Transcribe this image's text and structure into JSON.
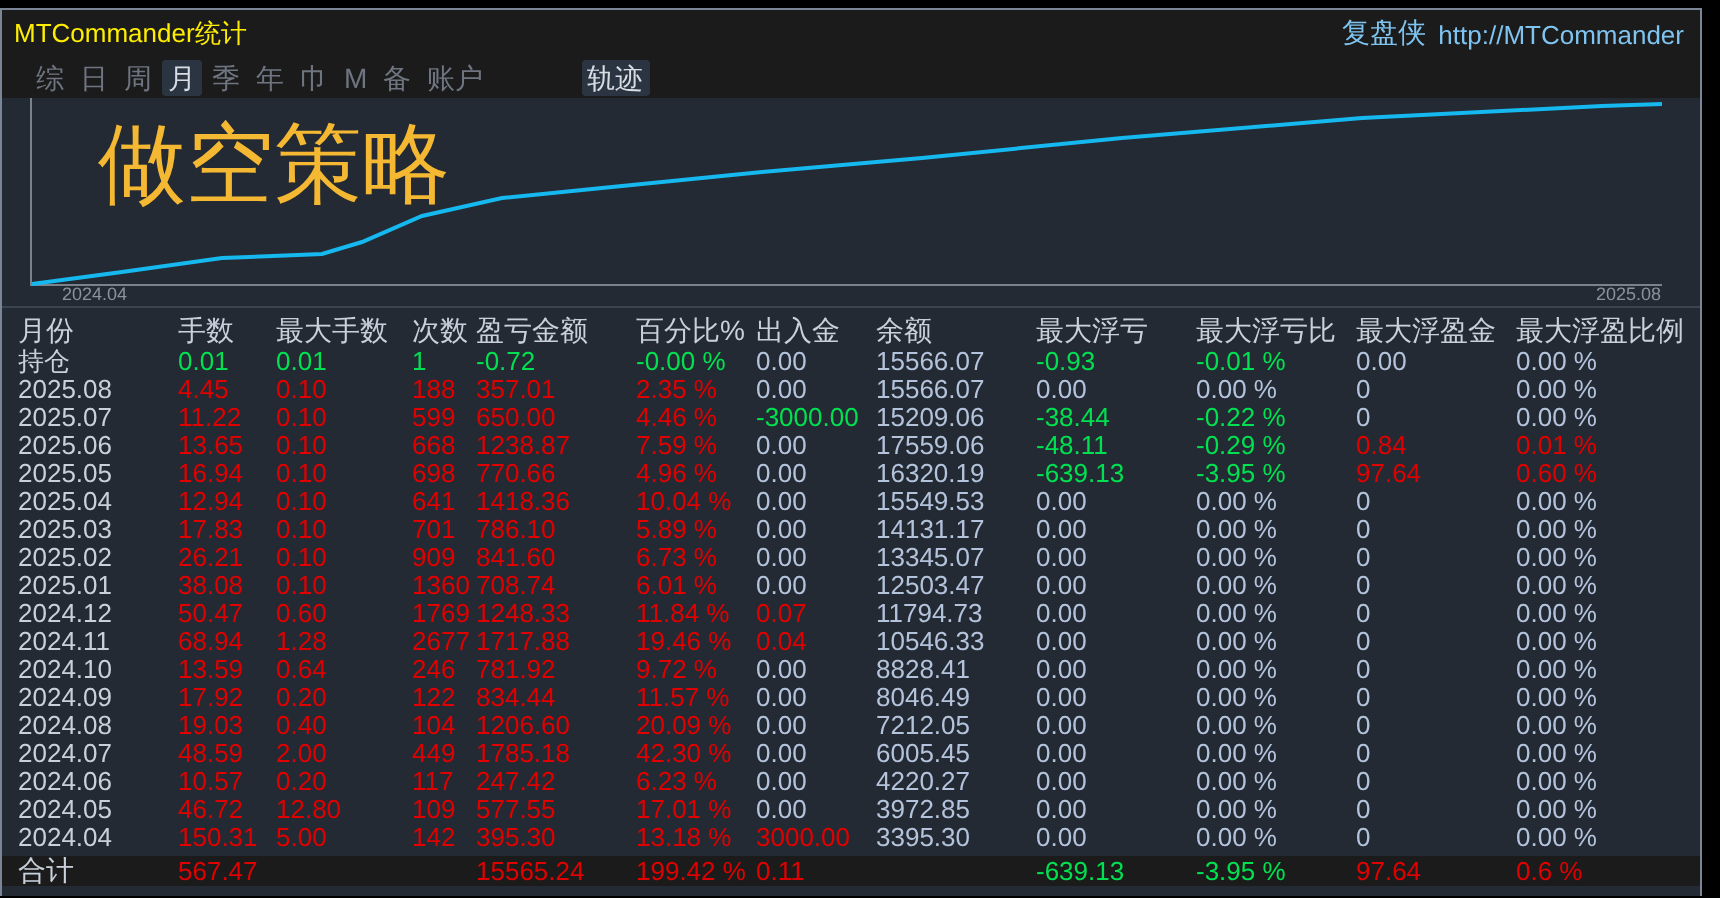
{
  "window": {
    "title": "MTCommander统计",
    "brand": "复盘侠",
    "url": "http://MTCommander"
  },
  "period_tabs": [
    {
      "label": "综",
      "selected": false
    },
    {
      "label": "日",
      "selected": false
    },
    {
      "label": "周",
      "selected": false
    },
    {
      "label": "月",
      "selected": true
    },
    {
      "label": "季",
      "selected": false
    },
    {
      "label": "年",
      "selected": false
    },
    {
      "label": "巾",
      "selected": false
    },
    {
      "label": "M",
      "selected": false
    },
    {
      "label": "备",
      "selected": false
    },
    {
      "label": "账户",
      "selected": false
    }
  ],
  "view_tabs": [
    {
      "label": "轨迹",
      "selected": true
    }
  ],
  "chart": {
    "overlay_title": "做空策略",
    "x_start": "2024.04",
    "x_end": "2025.08"
  },
  "table": {
    "label_column": "月份",
    "columns": [
      "手数",
      "最大手数",
      "次数",
      "盈亏金额",
      "百分比%",
      "出入金",
      "余额",
      "最大浮亏",
      "最大浮亏比",
      "最大浮盈金",
      "最大浮盈比例"
    ],
    "rows": [
      {
        "label": "持仓",
        "cells": [
          {
            "text": "0.01",
            "color": "#00e050"
          },
          {
            "text": "0.01",
            "color": "#00e050"
          },
          {
            "text": "1",
            "color": "#00e050"
          },
          {
            "text": "-0.72",
            "color": "#00e050"
          },
          {
            "text": "-0.00 %",
            "color": "#00e050"
          },
          {
            "text": "0.00",
            "color": "#b4c3dc"
          },
          {
            "text": "15566.07",
            "color": "#b4c3dc"
          },
          {
            "text": "-0.93",
            "color": "#00e050"
          },
          {
            "text": "-0.01 %",
            "color": "#00e050"
          },
          {
            "text": "0.00",
            "color": "#b4c3dc"
          },
          {
            "text": "0.00 %",
            "color": "#b4c3dc"
          }
        ]
      },
      {
        "label": "2025.08",
        "cells": [
          {
            "text": "4.45",
            "color": "#e00000"
          },
          {
            "text": "0.10",
            "color": "#e00000"
          },
          {
            "text": "188",
            "color": "#e00000"
          },
          {
            "text": "357.01",
            "color": "#e00000"
          },
          {
            "text": "2.35 %",
            "color": "#e00000"
          },
          {
            "text": "0.00",
            "color": "#b4c3dc"
          },
          {
            "text": "15566.07",
            "color": "#b4c3dc"
          },
          {
            "text": "0.00",
            "color": "#b4c3dc"
          },
          {
            "text": "0.00 %",
            "color": "#b4c3dc"
          },
          {
            "text": "0",
            "color": "#b4c3dc"
          },
          {
            "text": "0.00 %",
            "color": "#b4c3dc"
          }
        ]
      },
      {
        "label": "2025.07",
        "cells": [
          {
            "text": "11.22",
            "color": "#e00000"
          },
          {
            "text": "0.10",
            "color": "#e00000"
          },
          {
            "text": "599",
            "color": "#e00000"
          },
          {
            "text": "650.00",
            "color": "#e00000"
          },
          {
            "text": "4.46 %",
            "color": "#e00000"
          },
          {
            "text": "-3000.00",
            "color": "#00e050"
          },
          {
            "text": "15209.06",
            "color": "#b4c3dc"
          },
          {
            "text": "-38.44",
            "color": "#00e050"
          },
          {
            "text": "-0.22 %",
            "color": "#00e050"
          },
          {
            "text": "0",
            "color": "#b4c3dc"
          },
          {
            "text": "0.00 %",
            "color": "#b4c3dc"
          }
        ]
      },
      {
        "label": "2025.06",
        "cells": [
          {
            "text": "13.65",
            "color": "#e00000"
          },
          {
            "text": "0.10",
            "color": "#e00000"
          },
          {
            "text": "668",
            "color": "#e00000"
          },
          {
            "text": "1238.87",
            "color": "#e00000"
          },
          {
            "text": "7.59 %",
            "color": "#e00000"
          },
          {
            "text": "0.00",
            "color": "#b4c3dc"
          },
          {
            "text": "17559.06",
            "color": "#b4c3dc"
          },
          {
            "text": "-48.11",
            "color": "#00e050"
          },
          {
            "text": "-0.29 %",
            "color": "#00e050"
          },
          {
            "text": "0.84",
            "color": "#e00000"
          },
          {
            "text": "0.01 %",
            "color": "#e00000"
          }
        ]
      },
      {
        "label": "2025.05",
        "cells": [
          {
            "text": "16.94",
            "color": "#e00000"
          },
          {
            "text": "0.10",
            "color": "#e00000"
          },
          {
            "text": "698",
            "color": "#e00000"
          },
          {
            "text": "770.66",
            "color": "#e00000"
          },
          {
            "text": "4.96 %",
            "color": "#e00000"
          },
          {
            "text": "0.00",
            "color": "#b4c3dc"
          },
          {
            "text": "16320.19",
            "color": "#b4c3dc"
          },
          {
            "text": "-639.13",
            "color": "#00e050"
          },
          {
            "text": "-3.95 %",
            "color": "#00e050"
          },
          {
            "text": "97.64",
            "color": "#e00000"
          },
          {
            "text": "0.60 %",
            "color": "#e00000"
          }
        ]
      },
      {
        "label": "2025.04",
        "cells": [
          {
            "text": "12.94",
            "color": "#e00000"
          },
          {
            "text": "0.10",
            "color": "#e00000"
          },
          {
            "text": "641",
            "color": "#e00000"
          },
          {
            "text": "1418.36",
            "color": "#e00000"
          },
          {
            "text": "10.04 %",
            "color": "#e00000"
          },
          {
            "text": "0.00",
            "color": "#b4c3dc"
          },
          {
            "text": "15549.53",
            "color": "#b4c3dc"
          },
          {
            "text": "0.00",
            "color": "#b4c3dc"
          },
          {
            "text": "0.00 %",
            "color": "#b4c3dc"
          },
          {
            "text": "0",
            "color": "#b4c3dc"
          },
          {
            "text": "0.00 %",
            "color": "#b4c3dc"
          }
        ]
      },
      {
        "label": "2025.03",
        "cells": [
          {
            "text": "17.83",
            "color": "#e00000"
          },
          {
            "text": "0.10",
            "color": "#e00000"
          },
          {
            "text": "701",
            "color": "#e00000"
          },
          {
            "text": "786.10",
            "color": "#e00000"
          },
          {
            "text": "5.89 %",
            "color": "#e00000"
          },
          {
            "text": "0.00",
            "color": "#b4c3dc"
          },
          {
            "text": "14131.17",
            "color": "#b4c3dc"
          },
          {
            "text": "0.00",
            "color": "#b4c3dc"
          },
          {
            "text": "0.00 %",
            "color": "#b4c3dc"
          },
          {
            "text": "0",
            "color": "#b4c3dc"
          },
          {
            "text": "0.00 %",
            "color": "#b4c3dc"
          }
        ]
      },
      {
        "label": "2025.02",
        "cells": [
          {
            "text": "26.21",
            "color": "#e00000"
          },
          {
            "text": "0.10",
            "color": "#e00000"
          },
          {
            "text": "909",
            "color": "#e00000"
          },
          {
            "text": "841.60",
            "color": "#e00000"
          },
          {
            "text": "6.73 %",
            "color": "#e00000"
          },
          {
            "text": "0.00",
            "color": "#b4c3dc"
          },
          {
            "text": "13345.07",
            "color": "#b4c3dc"
          },
          {
            "text": "0.00",
            "color": "#b4c3dc"
          },
          {
            "text": "0.00 %",
            "color": "#b4c3dc"
          },
          {
            "text": "0",
            "color": "#b4c3dc"
          },
          {
            "text": "0.00 %",
            "color": "#b4c3dc"
          }
        ]
      },
      {
        "label": "2025.01",
        "cells": [
          {
            "text": "38.08",
            "color": "#e00000"
          },
          {
            "text": "0.10",
            "color": "#e00000"
          },
          {
            "text": "1360",
            "color": "#e00000"
          },
          {
            "text": "708.74",
            "color": "#e00000"
          },
          {
            "text": "6.01 %",
            "color": "#e00000"
          },
          {
            "text": "0.00",
            "color": "#b4c3dc"
          },
          {
            "text": "12503.47",
            "color": "#b4c3dc"
          },
          {
            "text": "0.00",
            "color": "#b4c3dc"
          },
          {
            "text": "0.00 %",
            "color": "#b4c3dc"
          },
          {
            "text": "0",
            "color": "#b4c3dc"
          },
          {
            "text": "0.00 %",
            "color": "#b4c3dc"
          }
        ]
      },
      {
        "label": "2024.12",
        "cells": [
          {
            "text": "50.47",
            "color": "#e00000"
          },
          {
            "text": "0.60",
            "color": "#e00000"
          },
          {
            "text": "1769",
            "color": "#e00000"
          },
          {
            "text": "1248.33",
            "color": "#e00000"
          },
          {
            "text": "11.84 %",
            "color": "#e00000"
          },
          {
            "text": "0.07",
            "color": "#e00000"
          },
          {
            "text": "11794.73",
            "color": "#b4c3dc"
          },
          {
            "text": "0.00",
            "color": "#b4c3dc"
          },
          {
            "text": "0.00 %",
            "color": "#b4c3dc"
          },
          {
            "text": "0",
            "color": "#b4c3dc"
          },
          {
            "text": "0.00 %",
            "color": "#b4c3dc"
          }
        ]
      },
      {
        "label": "2024.11",
        "cells": [
          {
            "text": "68.94",
            "color": "#e00000"
          },
          {
            "text": "1.28",
            "color": "#e00000"
          },
          {
            "text": "2677",
            "color": "#e00000"
          },
          {
            "text": "1717.88",
            "color": "#e00000"
          },
          {
            "text": "19.46 %",
            "color": "#e00000"
          },
          {
            "text": "0.04",
            "color": "#e00000"
          },
          {
            "text": "10546.33",
            "color": "#b4c3dc"
          },
          {
            "text": "0.00",
            "color": "#b4c3dc"
          },
          {
            "text": "0.00 %",
            "color": "#b4c3dc"
          },
          {
            "text": "0",
            "color": "#b4c3dc"
          },
          {
            "text": "0.00 %",
            "color": "#b4c3dc"
          }
        ]
      },
      {
        "label": "2024.10",
        "cells": [
          {
            "text": "13.59",
            "color": "#e00000"
          },
          {
            "text": "0.64",
            "color": "#e00000"
          },
          {
            "text": "246",
            "color": "#e00000"
          },
          {
            "text": "781.92",
            "color": "#e00000"
          },
          {
            "text": "9.72 %",
            "color": "#e00000"
          },
          {
            "text": "0.00",
            "color": "#b4c3dc"
          },
          {
            "text": "8828.41",
            "color": "#b4c3dc"
          },
          {
            "text": "0.00",
            "color": "#b4c3dc"
          },
          {
            "text": "0.00 %",
            "color": "#b4c3dc"
          },
          {
            "text": "0",
            "color": "#b4c3dc"
          },
          {
            "text": "0.00 %",
            "color": "#b4c3dc"
          }
        ]
      },
      {
        "label": "2024.09",
        "cells": [
          {
            "text": "17.92",
            "color": "#e00000"
          },
          {
            "text": "0.20",
            "color": "#e00000"
          },
          {
            "text": "122",
            "color": "#e00000"
          },
          {
            "text": "834.44",
            "color": "#e00000"
          },
          {
            "text": "11.57 %",
            "color": "#e00000"
          },
          {
            "text": "0.00",
            "color": "#b4c3dc"
          },
          {
            "text": "8046.49",
            "color": "#b4c3dc"
          },
          {
            "text": "0.00",
            "color": "#b4c3dc"
          },
          {
            "text": "0.00 %",
            "color": "#b4c3dc"
          },
          {
            "text": "0",
            "color": "#b4c3dc"
          },
          {
            "text": "0.00 %",
            "color": "#b4c3dc"
          }
        ]
      },
      {
        "label": "2024.08",
        "cells": [
          {
            "text": "19.03",
            "color": "#e00000"
          },
          {
            "text": "0.40",
            "color": "#e00000"
          },
          {
            "text": "104",
            "color": "#e00000"
          },
          {
            "text": "1206.60",
            "color": "#e00000"
          },
          {
            "text": "20.09 %",
            "color": "#e00000"
          },
          {
            "text": "0.00",
            "color": "#b4c3dc"
          },
          {
            "text": "7212.05",
            "color": "#b4c3dc"
          },
          {
            "text": "0.00",
            "color": "#b4c3dc"
          },
          {
            "text": "0.00 %",
            "color": "#b4c3dc"
          },
          {
            "text": "0",
            "color": "#b4c3dc"
          },
          {
            "text": "0.00 %",
            "color": "#b4c3dc"
          }
        ]
      },
      {
        "label": "2024.07",
        "cells": [
          {
            "text": "48.59",
            "color": "#e00000"
          },
          {
            "text": "2.00",
            "color": "#e00000"
          },
          {
            "text": "449",
            "color": "#e00000"
          },
          {
            "text": "1785.18",
            "color": "#e00000"
          },
          {
            "text": "42.30 %",
            "color": "#e00000"
          },
          {
            "text": "0.00",
            "color": "#b4c3dc"
          },
          {
            "text": "6005.45",
            "color": "#b4c3dc"
          },
          {
            "text": "0.00",
            "color": "#b4c3dc"
          },
          {
            "text": "0.00 %",
            "color": "#b4c3dc"
          },
          {
            "text": "0",
            "color": "#b4c3dc"
          },
          {
            "text": "0.00 %",
            "color": "#b4c3dc"
          }
        ]
      },
      {
        "label": "2024.06",
        "cells": [
          {
            "text": "10.57",
            "color": "#e00000"
          },
          {
            "text": "0.20",
            "color": "#e00000"
          },
          {
            "text": "117",
            "color": "#e00000"
          },
          {
            "text": "247.42",
            "color": "#e00000"
          },
          {
            "text": "6.23 %",
            "color": "#e00000"
          },
          {
            "text": "0.00",
            "color": "#b4c3dc"
          },
          {
            "text": "4220.27",
            "color": "#b4c3dc"
          },
          {
            "text": "0.00",
            "color": "#b4c3dc"
          },
          {
            "text": "0.00 %",
            "color": "#b4c3dc"
          },
          {
            "text": "0",
            "color": "#b4c3dc"
          },
          {
            "text": "0.00 %",
            "color": "#b4c3dc"
          }
        ]
      },
      {
        "label": "2024.05",
        "cells": [
          {
            "text": "46.72",
            "color": "#e00000"
          },
          {
            "text": "12.80",
            "color": "#e00000"
          },
          {
            "text": "109",
            "color": "#e00000"
          },
          {
            "text": "577.55",
            "color": "#e00000"
          },
          {
            "text": "17.01 %",
            "color": "#e00000"
          },
          {
            "text": "0.00",
            "color": "#b4c3dc"
          },
          {
            "text": "3972.85",
            "color": "#b4c3dc"
          },
          {
            "text": "0.00",
            "color": "#b4c3dc"
          },
          {
            "text": "0.00 %",
            "color": "#b4c3dc"
          },
          {
            "text": "0",
            "color": "#b4c3dc"
          },
          {
            "text": "0.00 %",
            "color": "#b4c3dc"
          }
        ]
      },
      {
        "label": "2024.04",
        "cells": [
          {
            "text": "150.31",
            "color": "#e00000"
          },
          {
            "text": "5.00",
            "color": "#e00000"
          },
          {
            "text": "142",
            "color": "#e00000"
          },
          {
            "text": "395.30",
            "color": "#e00000"
          },
          {
            "text": "13.18 %",
            "color": "#e00000"
          },
          {
            "text": "3000.00",
            "color": "#e00000"
          },
          {
            "text": "3395.30",
            "color": "#b4c3dc"
          },
          {
            "text": "0.00",
            "color": "#b4c3dc"
          },
          {
            "text": "0.00 %",
            "color": "#b4c3dc"
          },
          {
            "text": "0",
            "color": "#b4c3dc"
          },
          {
            "text": "0.00 %",
            "color": "#b4c3dc"
          }
        ]
      }
    ],
    "total": {
      "label": "合计",
      "cells": [
        {
          "text": "567.47",
          "color": "#e00000"
        },
        null,
        null,
        {
          "text": "15565.24",
          "color": "#e00000"
        },
        {
          "text": "199.42 %",
          "color": "#e00000"
        },
        {
          "text": "0.11",
          "color": "#e00000"
        },
        null,
        {
          "text": "-639.13",
          "color": "#00e050"
        },
        {
          "text": "-3.95 %",
          "color": "#00e050"
        },
        {
          "text": "97.64",
          "color": "#e00000"
        },
        {
          "text": "0.6 %",
          "color": "#e00000"
        }
      ]
    }
  }
}
